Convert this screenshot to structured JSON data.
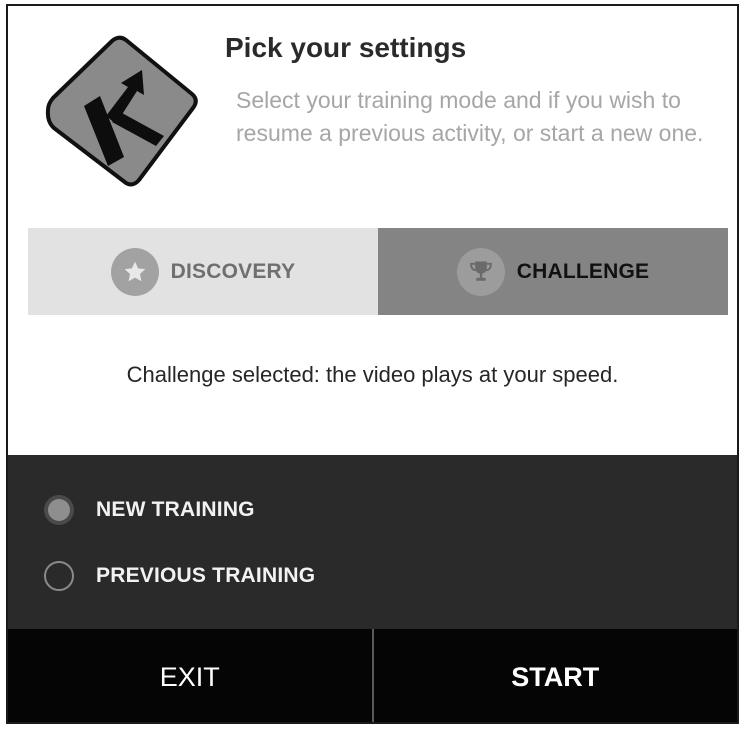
{
  "header": {
    "title": "Pick your settings",
    "subtitle": "Select your training mode and if you wish to resume a previous activity, or start a new one."
  },
  "logo": {
    "letter": "K",
    "icon": "k-arrow-logo"
  },
  "modes": {
    "selected": "challenge",
    "tabs": [
      {
        "id": "discovery",
        "label": "DISCOVERY",
        "icon": "star-icon"
      },
      {
        "id": "challenge",
        "label": "CHALLENGE",
        "icon": "trophy-icon"
      }
    ],
    "caption": "Challenge selected: the video plays at your speed."
  },
  "training": {
    "selected": "new",
    "options": [
      {
        "id": "new",
        "label": "NEW TRAINING"
      },
      {
        "id": "previous",
        "label": "PREVIOUS TRAINING"
      }
    ]
  },
  "actions": {
    "exit_label": "EXIT",
    "start_label": "START"
  },
  "colors": {
    "discovery_tab_bg": "#e2e2e2",
    "challenge_tab_bg": "#848484",
    "options_panel_bg": "#2a2a2a",
    "actions_bg": "#050505",
    "subtitle_text": "#a6a6a6"
  }
}
